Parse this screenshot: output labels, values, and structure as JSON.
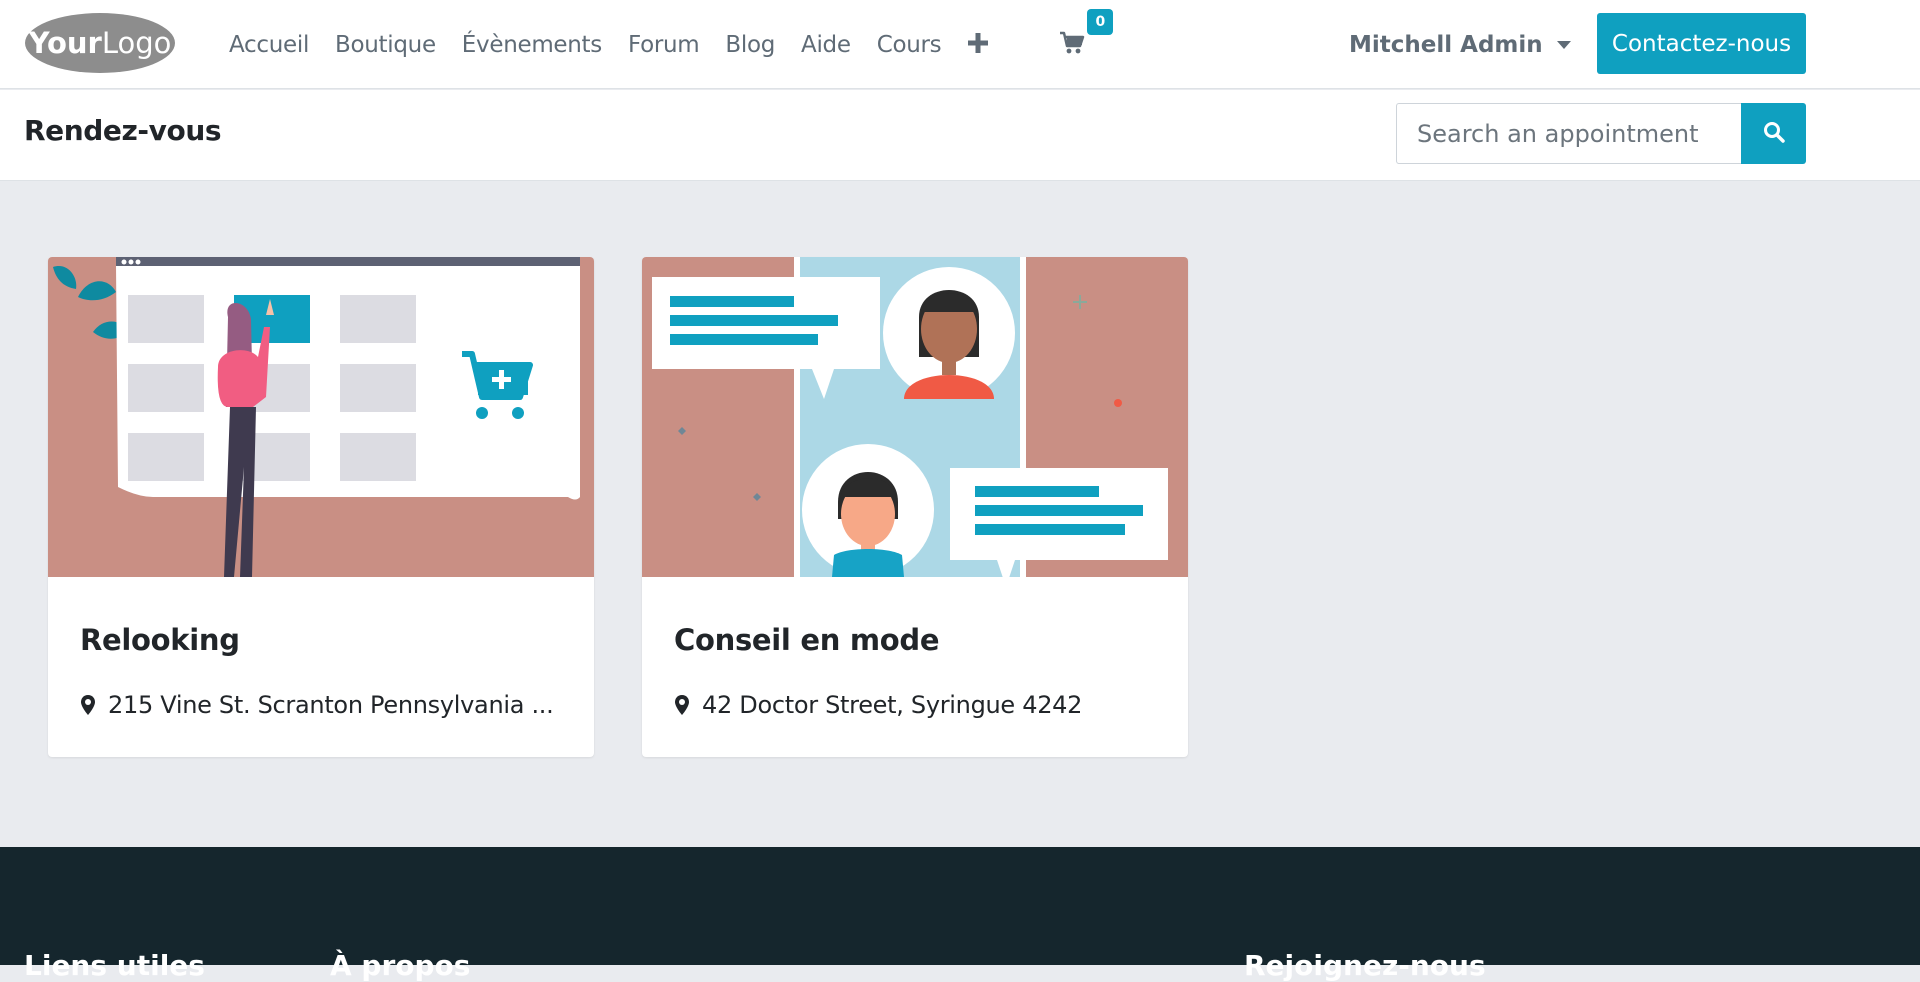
{
  "header": {
    "logo_text": "YourLogo",
    "nav": [
      {
        "label": "Accueil"
      },
      {
        "label": "Boutique"
      },
      {
        "label": "Évènements"
      },
      {
        "label": "Forum"
      },
      {
        "label": "Blog"
      },
      {
        "label": "Aide"
      },
      {
        "label": "Cours"
      }
    ],
    "cart_count": "0",
    "user_name": "Mitchell Admin",
    "contact_label": "Contactez-nous"
  },
  "subheader": {
    "title": "Rendez-vous",
    "search_placeholder": "Search an appointment"
  },
  "cards": [
    {
      "title": "Relooking",
      "location": "215 Vine St. Scranton Pennsylvania ..."
    },
    {
      "title": "Conseil en mode",
      "location": "42 Doctor Street, Syringue 4242"
    }
  ],
  "footer": {
    "headings": [
      "Liens utiles",
      "À propos",
      "Rejoignez-nous"
    ]
  },
  "colors": {
    "accent": "#0fa0c0",
    "footer_bg": "#15262d",
    "page_bg": "#e9ebef"
  },
  "icons": [
    "plus-icon",
    "cart-icon",
    "caret-down-icon",
    "search-icon",
    "map-marker-icon"
  ]
}
